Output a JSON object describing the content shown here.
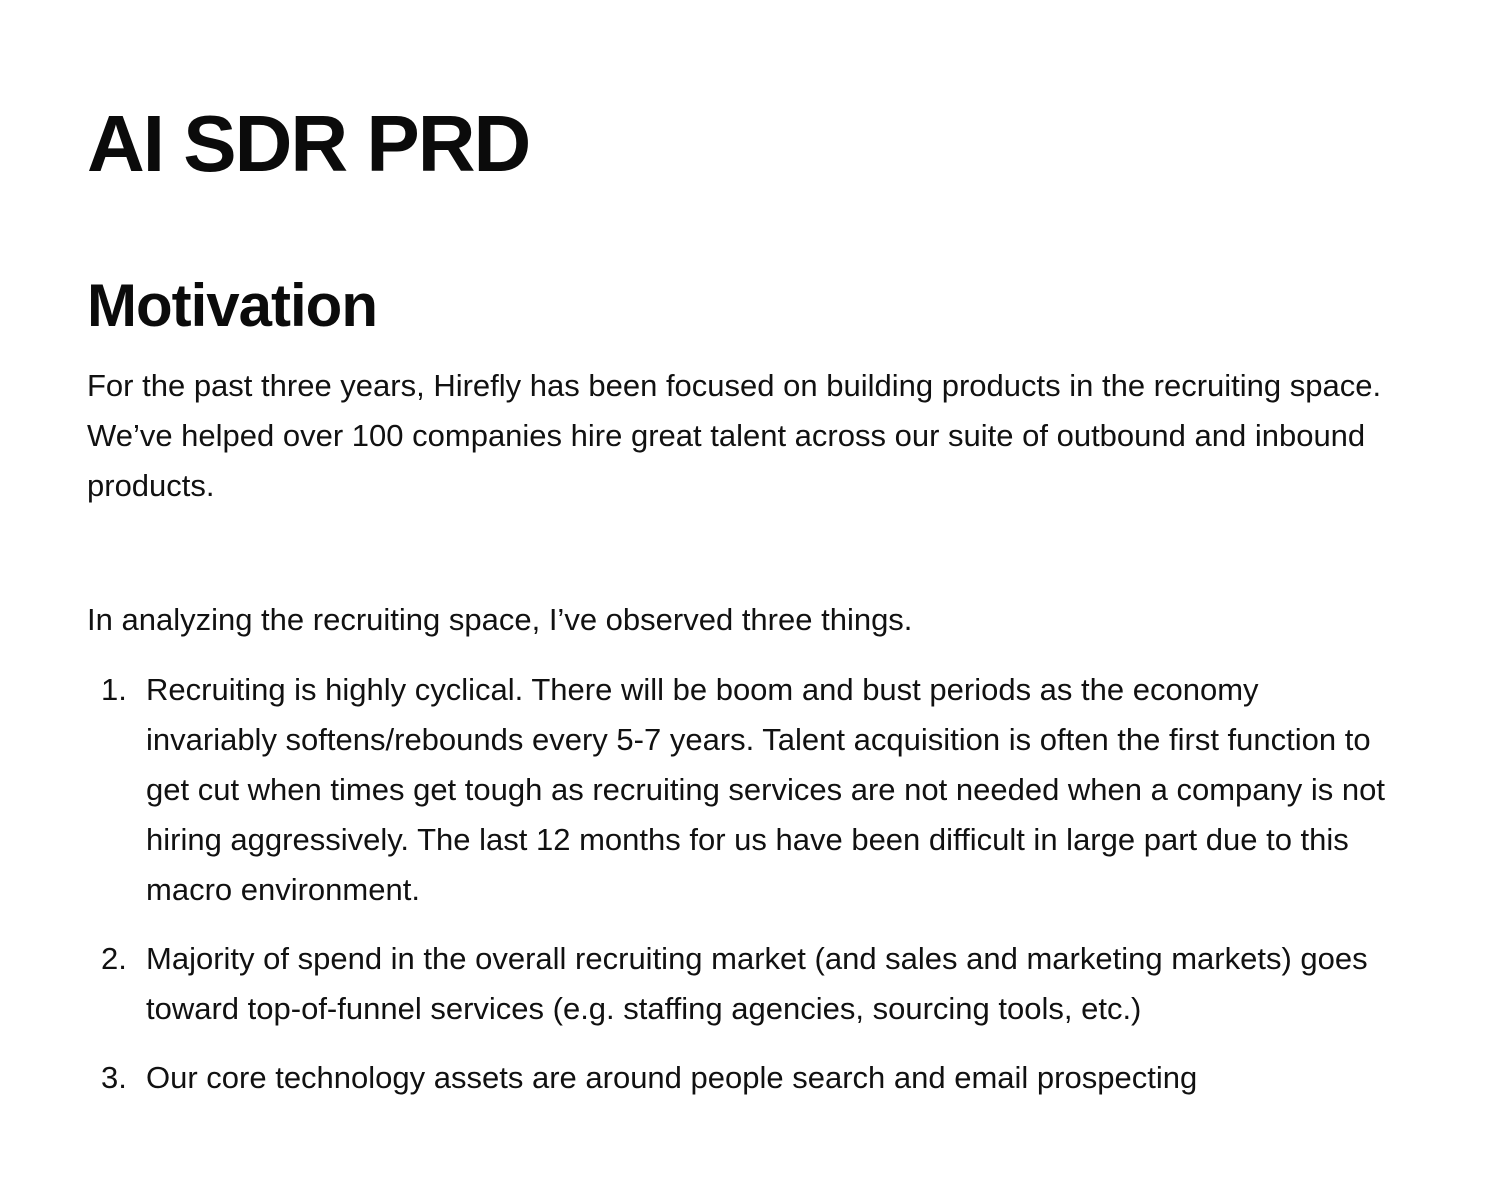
{
  "document": {
    "title": "AI SDR PRD",
    "sections": [
      {
        "heading": "Motivation",
        "paragraphs": [
          "For the past three years, Hirefly has been focused on building products in the recruiting space. We’ve helped over 100 companies hire great talent across our suite of outbound and inbound products.",
          "In analyzing the recruiting space, I’ve observed three things."
        ],
        "list": [
          {
            "marker": "1.",
            "text": "Recruiting is highly cyclical. There will be boom and bust periods as the economy invariably softens/rebounds every 5-7 years. Talent acquisition is often the first function to get cut when times get tough as recruiting services are not needed when a company is not hiring aggressively. The last 12 months for us have been difficult in large part due to this macro environment."
          },
          {
            "marker": "2.",
            "text": "Majority of spend in the overall recruiting market (and sales and marketing markets) goes toward top-of-funnel services (e.g. staffing agencies, sourcing tools, etc.)"
          },
          {
            "marker": "3.",
            "text": "Our core technology assets are around people search and email prospecting"
          }
        ]
      }
    ]
  }
}
